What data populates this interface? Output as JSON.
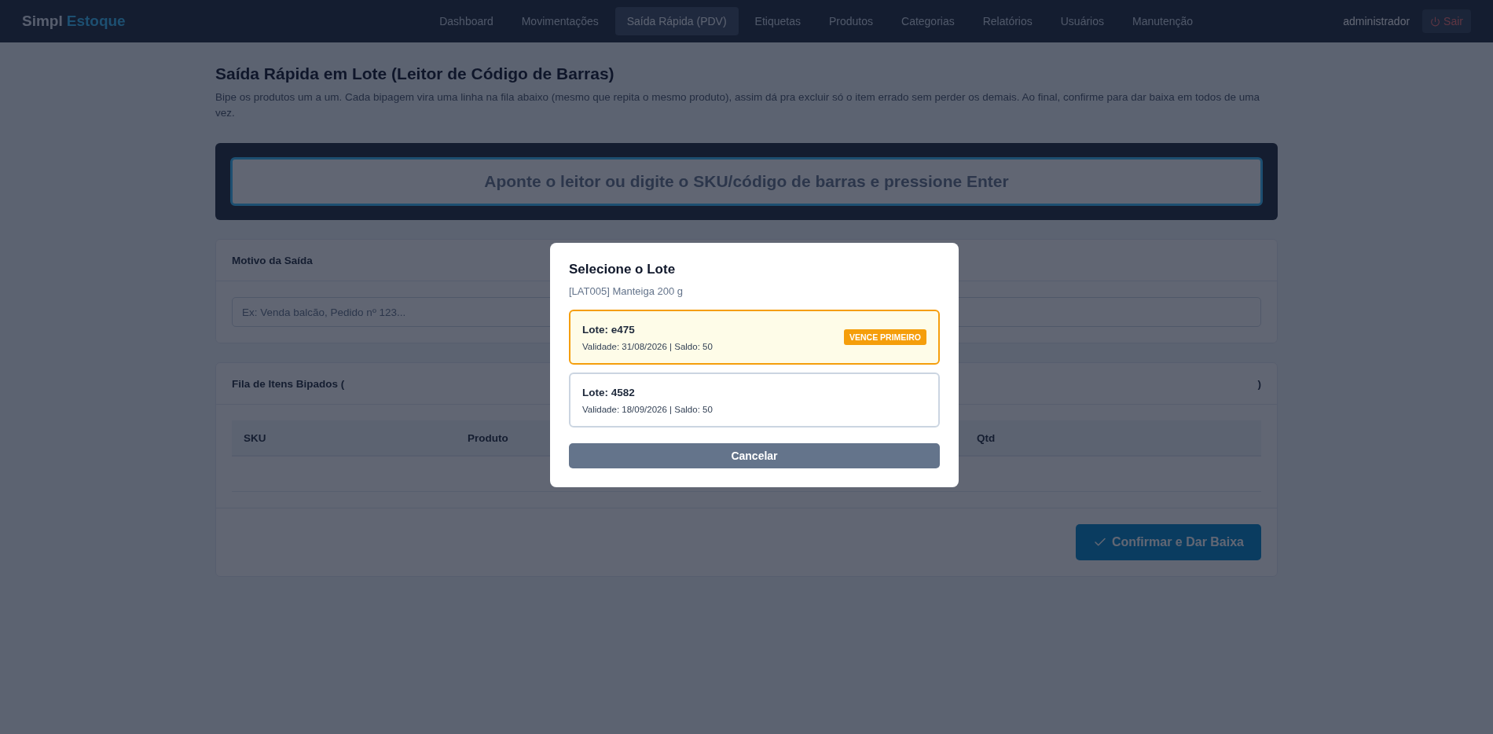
{
  "navbar": {
    "brand_first": "Simpl",
    "brand_second": "Estoque",
    "items": [
      {
        "label": "Dashboard",
        "selected": false
      },
      {
        "label": "Movimentações",
        "selected": false
      },
      {
        "label": "Saída Rápida (PDV)",
        "selected": true
      },
      {
        "label": "Etiquetas",
        "selected": false
      },
      {
        "label": "Produtos",
        "selected": false
      },
      {
        "label": "Categorias",
        "selected": false
      },
      {
        "label": "Relatórios",
        "selected": false
      },
      {
        "label": "Usuários",
        "selected": false
      },
      {
        "label": "Manutenção",
        "selected": false
      }
    ],
    "user": "administrador",
    "logout": "Sair"
  },
  "page": {
    "title": "Saída Rápida em Lote (Leitor de Código de Barras)",
    "description": "Bipe os produtos um a um. Cada bipagem vira uma linha na fila abaixo (mesmo que repita o mesmo produto), assim dá pra excluir só o item errado sem perder os demais. Ao final, confirme para dar baixa em todos de uma vez."
  },
  "scanner": {
    "placeholder": "Aponte o leitor ou digite o SKU/código de barras e pressione Enter"
  },
  "reason": {
    "title": "Motivo da Saída",
    "placeholder": "Ex: Venda balcão, Pedido nº 123..."
  },
  "queue": {
    "title_start": "Fila de Itens Bipados (",
    "title_end": ")",
    "columns": [
      {
        "label": "SKU"
      },
      {
        "label": "Produto"
      },
      {
        "label": "Qtd"
      }
    ],
    "confirm": "Confirmar e Dar Baixa"
  },
  "modal": {
    "title": "Selecione o Lote",
    "product": "[LAT005] Manteiga 200 g",
    "lots": [
      {
        "name": "Lote: e475",
        "details": "Validade: 31/08/2026 | Saldo: 50",
        "selected": true,
        "badge": "VENCE PRIMEIRO"
      },
      {
        "name": "Lote: 4582",
        "details": "Validade: 18/09/2026 | Saldo: 50",
        "selected": false
      }
    ],
    "cancel": "Cancelar"
  }
}
